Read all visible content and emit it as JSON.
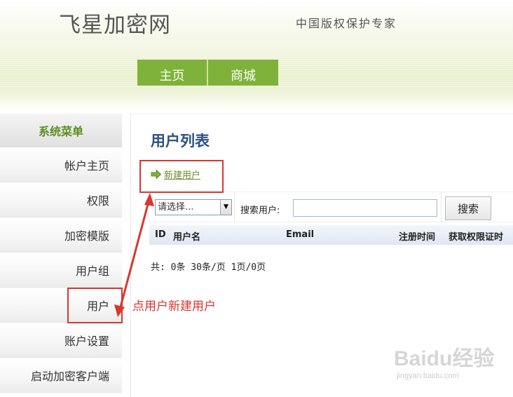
{
  "header": {
    "site_title": "飞星加密网",
    "slogan": "中国版权保护专家",
    "nav": [
      {
        "label": "主页"
      },
      {
        "label": "商城"
      }
    ]
  },
  "sidebar": {
    "heading": "系统菜单",
    "items": [
      {
        "label": "帐户主页"
      },
      {
        "label": "权限"
      },
      {
        "label": "加密模版"
      },
      {
        "label": "用户组"
      },
      {
        "label": "用户"
      },
      {
        "label": "账户设置"
      },
      {
        "label": "启动加密客户端"
      }
    ]
  },
  "main": {
    "title": "用户列表",
    "new_user_link": "新建用户",
    "search": {
      "select_value": "请选择...",
      "label": "搜索用户:",
      "input_value": "",
      "button": "搜索"
    },
    "table": {
      "columns": [
        "ID",
        "用户名",
        "Email",
        "注册时间",
        "获取权限证时"
      ]
    },
    "pagination": "共: 0条 30条/页 1页/0页"
  },
  "annotation": {
    "text": "点用户新建用户",
    "color": "#d93630"
  },
  "watermark": {
    "logo": "Baidu经验",
    "url": "jingyan.baidu.com"
  },
  "colors": {
    "nav_green": "#7fb23a",
    "sidebar_heading": "#5d8f1f",
    "title_blue": "#2b4f86",
    "annotation_red": "#d93630"
  }
}
